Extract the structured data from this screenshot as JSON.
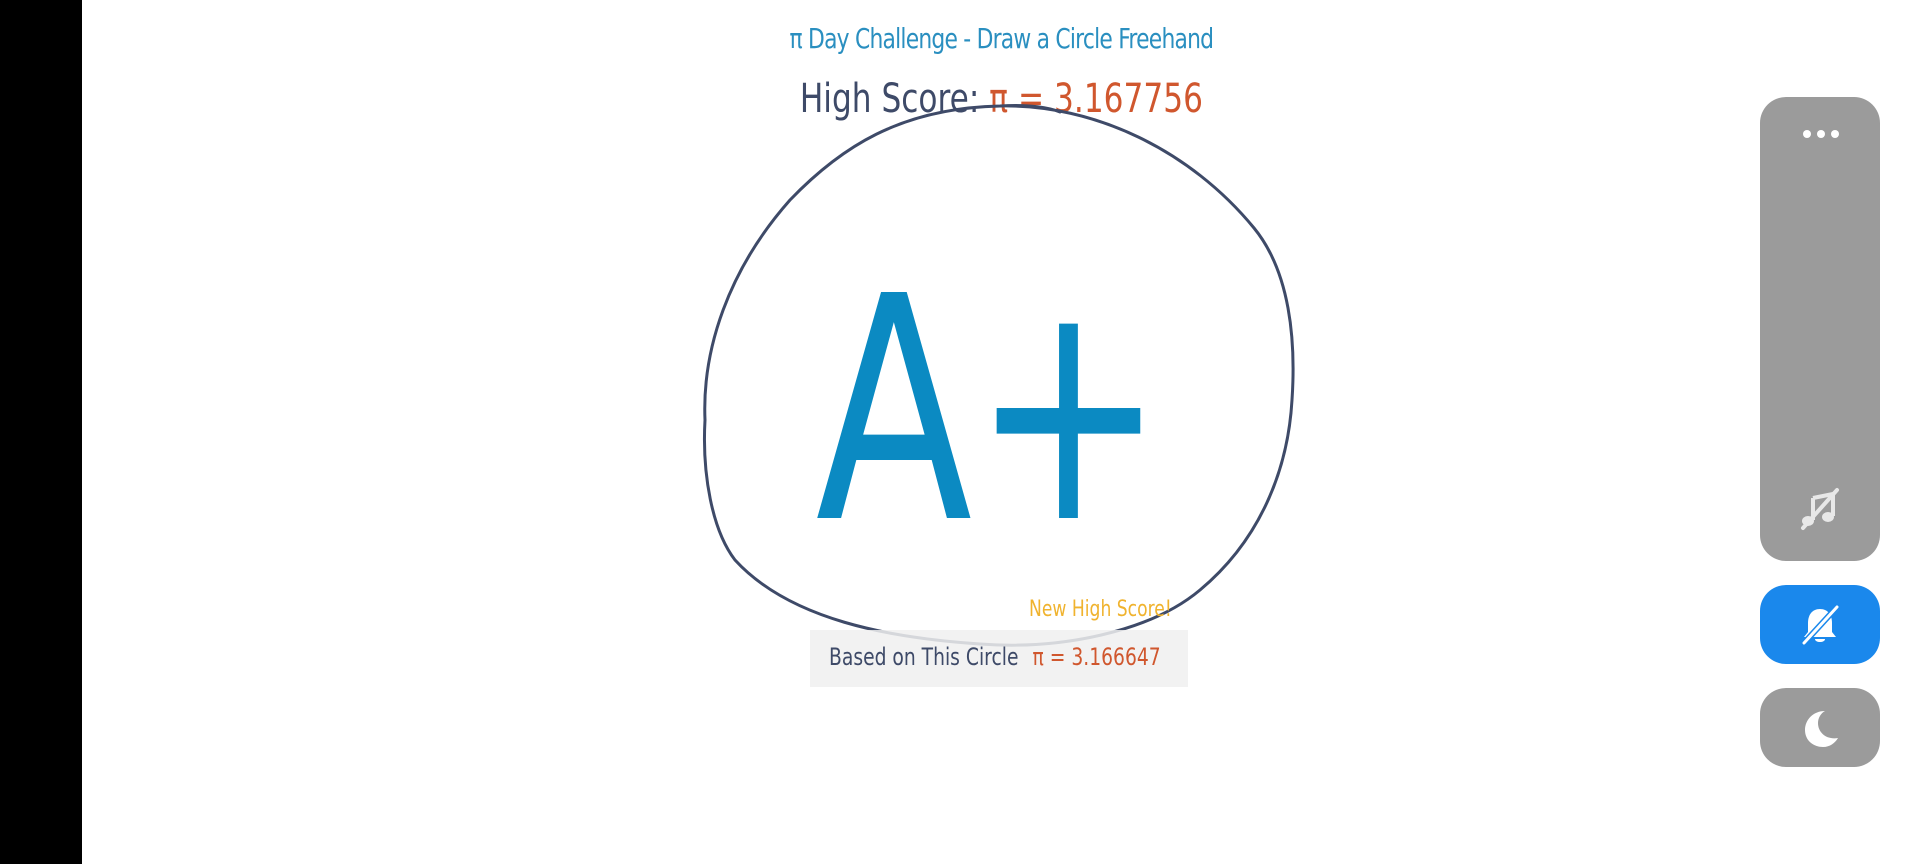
{
  "game": {
    "title": "π Day Challenge - Draw a Circle Freehand",
    "high_score_label": "High Score:",
    "high_score_value": "π = 3.167756",
    "grade": "A+",
    "new_high_score": "New High Score!",
    "based_on_label": "Based on This Circle",
    "based_on_value": "π = 3.166647"
  },
  "side_panel": {
    "more_icon": "more-horizontal-icon",
    "music_icon": "music-off-icon",
    "bell_icon": "bell-off-icon",
    "moon_icon": "moon-icon"
  },
  "colors": {
    "title": "#2a8fc0",
    "grade": "#0b8ac2",
    "circle_stroke": "#3e4a68",
    "pi_value": "#d0572e",
    "new_high": "#f0b32e",
    "panel_gray": "#9b9b9b",
    "bell_active": "#1a88ec"
  }
}
